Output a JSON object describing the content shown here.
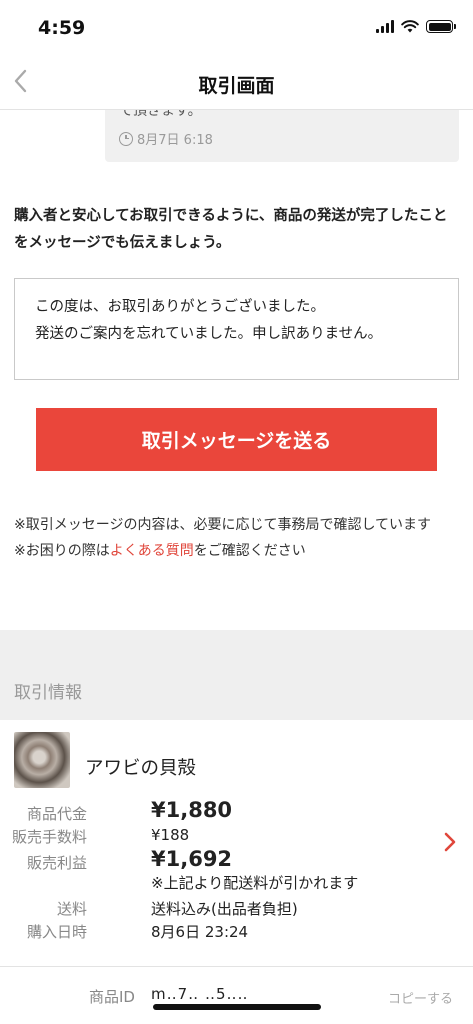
{
  "status": {
    "time": "4:59"
  },
  "nav": {
    "title": "取引画面"
  },
  "previous_message": {
    "cut_text": "て頂きます。",
    "time": "8月7日 6:18"
  },
  "hint": "購入者と安心してお取引できるように、商品の発送が完了したことをメッセージでも伝えましょう。",
  "message_input": {
    "value": "この度は、お取引ありがとうございました。\n発送のご案内を忘れていました。申し訳ありません。"
  },
  "send_button": {
    "label": "取引メッセージを送る"
  },
  "notes": {
    "line1": "※取引メッセージの内容は、必要に応じて事務局で確認しています",
    "line2_prefix": "※お困りの際は",
    "faq_link": "よくある質問",
    "line2_suffix": "をご確認ください"
  },
  "section": {
    "title": "取引情報"
  },
  "product": {
    "name": "アワビの貝殻",
    "price_label": "商品代金",
    "price": "¥1,880",
    "fee_label": "販売手数料",
    "fee": "¥188",
    "profit_label": "販売利益",
    "profit": "¥1,692",
    "profit_note": "※上記より配送料が引かれます",
    "shipping_label": "送料",
    "shipping": "送料込み(出品者負担)",
    "purchase_label": "購入日時",
    "purchase_date": "8月6日 23:24"
  },
  "item_id": {
    "label": "商品ID",
    "value": "m‥7‥ ‥5‥‥",
    "copy_label": "コピーする"
  },
  "colors": {
    "accent": "#ea463b",
    "link": "#e0463b"
  },
  "icons": [
    "back-chevron-icon",
    "clock-icon",
    "chevron-right-icon",
    "signal-icon",
    "wifi-icon",
    "battery-icon"
  ]
}
